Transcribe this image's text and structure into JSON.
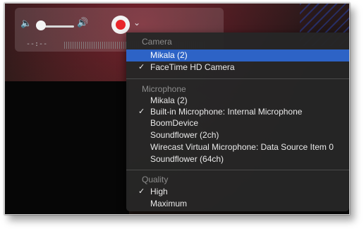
{
  "player": {
    "time": "--:--"
  },
  "icons": {
    "volume_low": "speaker-low-icon",
    "volume_high": "speaker-high-icon",
    "record": "record-icon",
    "chevron": "chevron-down-icon",
    "check": "checkmark-icon"
  },
  "colors": {
    "record_red": "#e8262a",
    "menu_bg": "#262626",
    "highlight": "#2d63c6",
    "header_text": "#8c8c8c"
  },
  "menu": {
    "camera_header": "Camera",
    "camera_items": [
      {
        "label": "Mikala (2)",
        "checked": false,
        "highlighted": true
      },
      {
        "label": "FaceTime HD Camera",
        "checked": true,
        "highlighted": false
      }
    ],
    "microphone_header": "Microphone",
    "microphone_items": [
      {
        "label": "Mikala (2)",
        "checked": false
      },
      {
        "label": "Built-in Microphone: Internal Microphone",
        "checked": true
      },
      {
        "label": "BoomDevice",
        "checked": false
      },
      {
        "label": "Soundflower (2ch)",
        "checked": false
      },
      {
        "label": "Wirecast Virtual Microphone: Data Source Item 0",
        "checked": false
      },
      {
        "label": "Soundflower (64ch)",
        "checked": false
      }
    ],
    "quality_header": "Quality",
    "quality_items": [
      {
        "label": "High",
        "checked": true
      },
      {
        "label": "Maximum",
        "checked": false
      }
    ],
    "check_glyph": "✓"
  }
}
